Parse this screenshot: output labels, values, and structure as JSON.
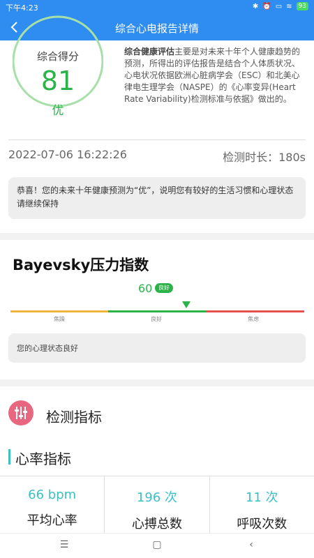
{
  "status_bar": {
    "time": "下午4:23",
    "battery": "93"
  },
  "app_bar": {
    "title": "综合心电报告详情"
  },
  "summary": {
    "score_label": "综合得分",
    "score_value": "81",
    "grade": "优",
    "desc_bold": "综合健康评估",
    "desc_rest": "主要是对未来十年个人健康趋势的预测，所得出的评估报告是结合个人体质状况、心电状况依据欧洲心脏病学会（ESC）和北美心律电生理学会（NASPE）的《心率变异(Heart Rate Variability)检测标准与依据》做出的。",
    "datetime": "2022-07-06 16:22:26",
    "duration": "检测时长：180s",
    "message": "恭喜！您的未来十年健康预测为“优”，说明您有较好的生活习惯和心理状态请继续保持"
  },
  "bayevsky": {
    "title": "Bayevsky压力指数",
    "value": "60",
    "badge": "良好",
    "labels": [
      "焦躁",
      "良好",
      "焦虑"
    ],
    "message": "您的心理状态良好"
  },
  "indicators": {
    "title": "检测指标",
    "section": "心率指标",
    "cells": [
      {
        "value": "66 bpm",
        "label": "平均心率"
      },
      {
        "value": "196 次",
        "label": "心搏总数"
      },
      {
        "value": "11 次",
        "label": "呼吸次数"
      }
    ]
  },
  "colors": {
    "primary": "#2f8cf0",
    "good": "#2bb34a",
    "teal": "#3cc0c5",
    "pink": "#e8667e"
  }
}
